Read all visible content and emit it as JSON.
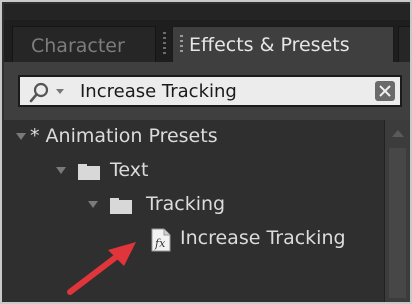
{
  "tabs": {
    "character_label": "Character",
    "effects_label": "Effects & Presets"
  },
  "search": {
    "value": "Increase Tracking"
  },
  "tree": {
    "animation_presets": "* Animation Presets",
    "text": "Text",
    "tracking": "Tracking",
    "increase_tracking": "Increase Tracking"
  },
  "colors": {
    "annotation_arrow": "#e0353b"
  }
}
